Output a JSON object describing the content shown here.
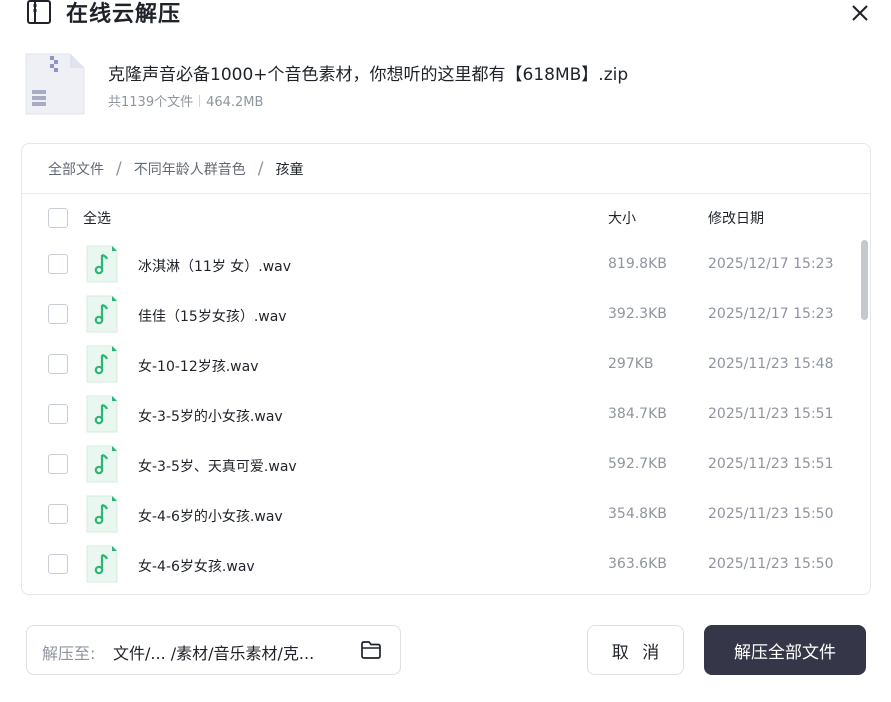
{
  "dialog": {
    "title": "在线云解压"
  },
  "archive": {
    "name": "克隆声音必备1000+个音色素材，你想听的这里都有【618MB】.zip",
    "file_count": "共1139个文件",
    "total_size": "464.2MB"
  },
  "breadcrumb": [
    "全部文件",
    "不同年龄人群音色",
    "孩童"
  ],
  "table": {
    "select_all_label": "全选",
    "columns": {
      "size": "大小",
      "modified": "修改日期"
    },
    "rows": [
      {
        "name": "冰淇淋（11岁 女）.wav",
        "size": "819.8KB",
        "date": "2025/12/17 15:23"
      },
      {
        "name": "佳佳（15岁女孩）.wav",
        "size": "392.3KB",
        "date": "2025/12/17 15:23"
      },
      {
        "name": "女-10-12岁孩.wav",
        "size": "297KB",
        "date": "2025/11/23 15:48"
      },
      {
        "name": "女-3-5岁的小女孩.wav",
        "size": "384.7KB",
        "date": "2025/11/23 15:51"
      },
      {
        "name": "女-3-5岁、天真可爱.wav",
        "size": "592.7KB",
        "date": "2025/11/23 15:51"
      },
      {
        "name": "女-4-6岁的小女孩.wav",
        "size": "354.8KB",
        "date": "2025/11/23 15:50"
      },
      {
        "name": "女-4-6岁女孩.wav",
        "size": "363.6KB",
        "date": "2025/11/23 15:50"
      }
    ]
  },
  "destination": {
    "label": "解压至:",
    "path": "文件/... /素材/音乐素材/克..."
  },
  "actions": {
    "cancel": "取 消",
    "extract_all": "解压全部文件"
  },
  "icons": {
    "title": "zip-file-icon",
    "close": "close-icon",
    "archive": "zip-archive-icon",
    "file": "audio-file-icon",
    "folder": "folder-icon"
  },
  "colors": {
    "primary_button": "#353748",
    "audio_icon": "#2bb673",
    "audio_icon_bg": "#eaf7f0"
  }
}
